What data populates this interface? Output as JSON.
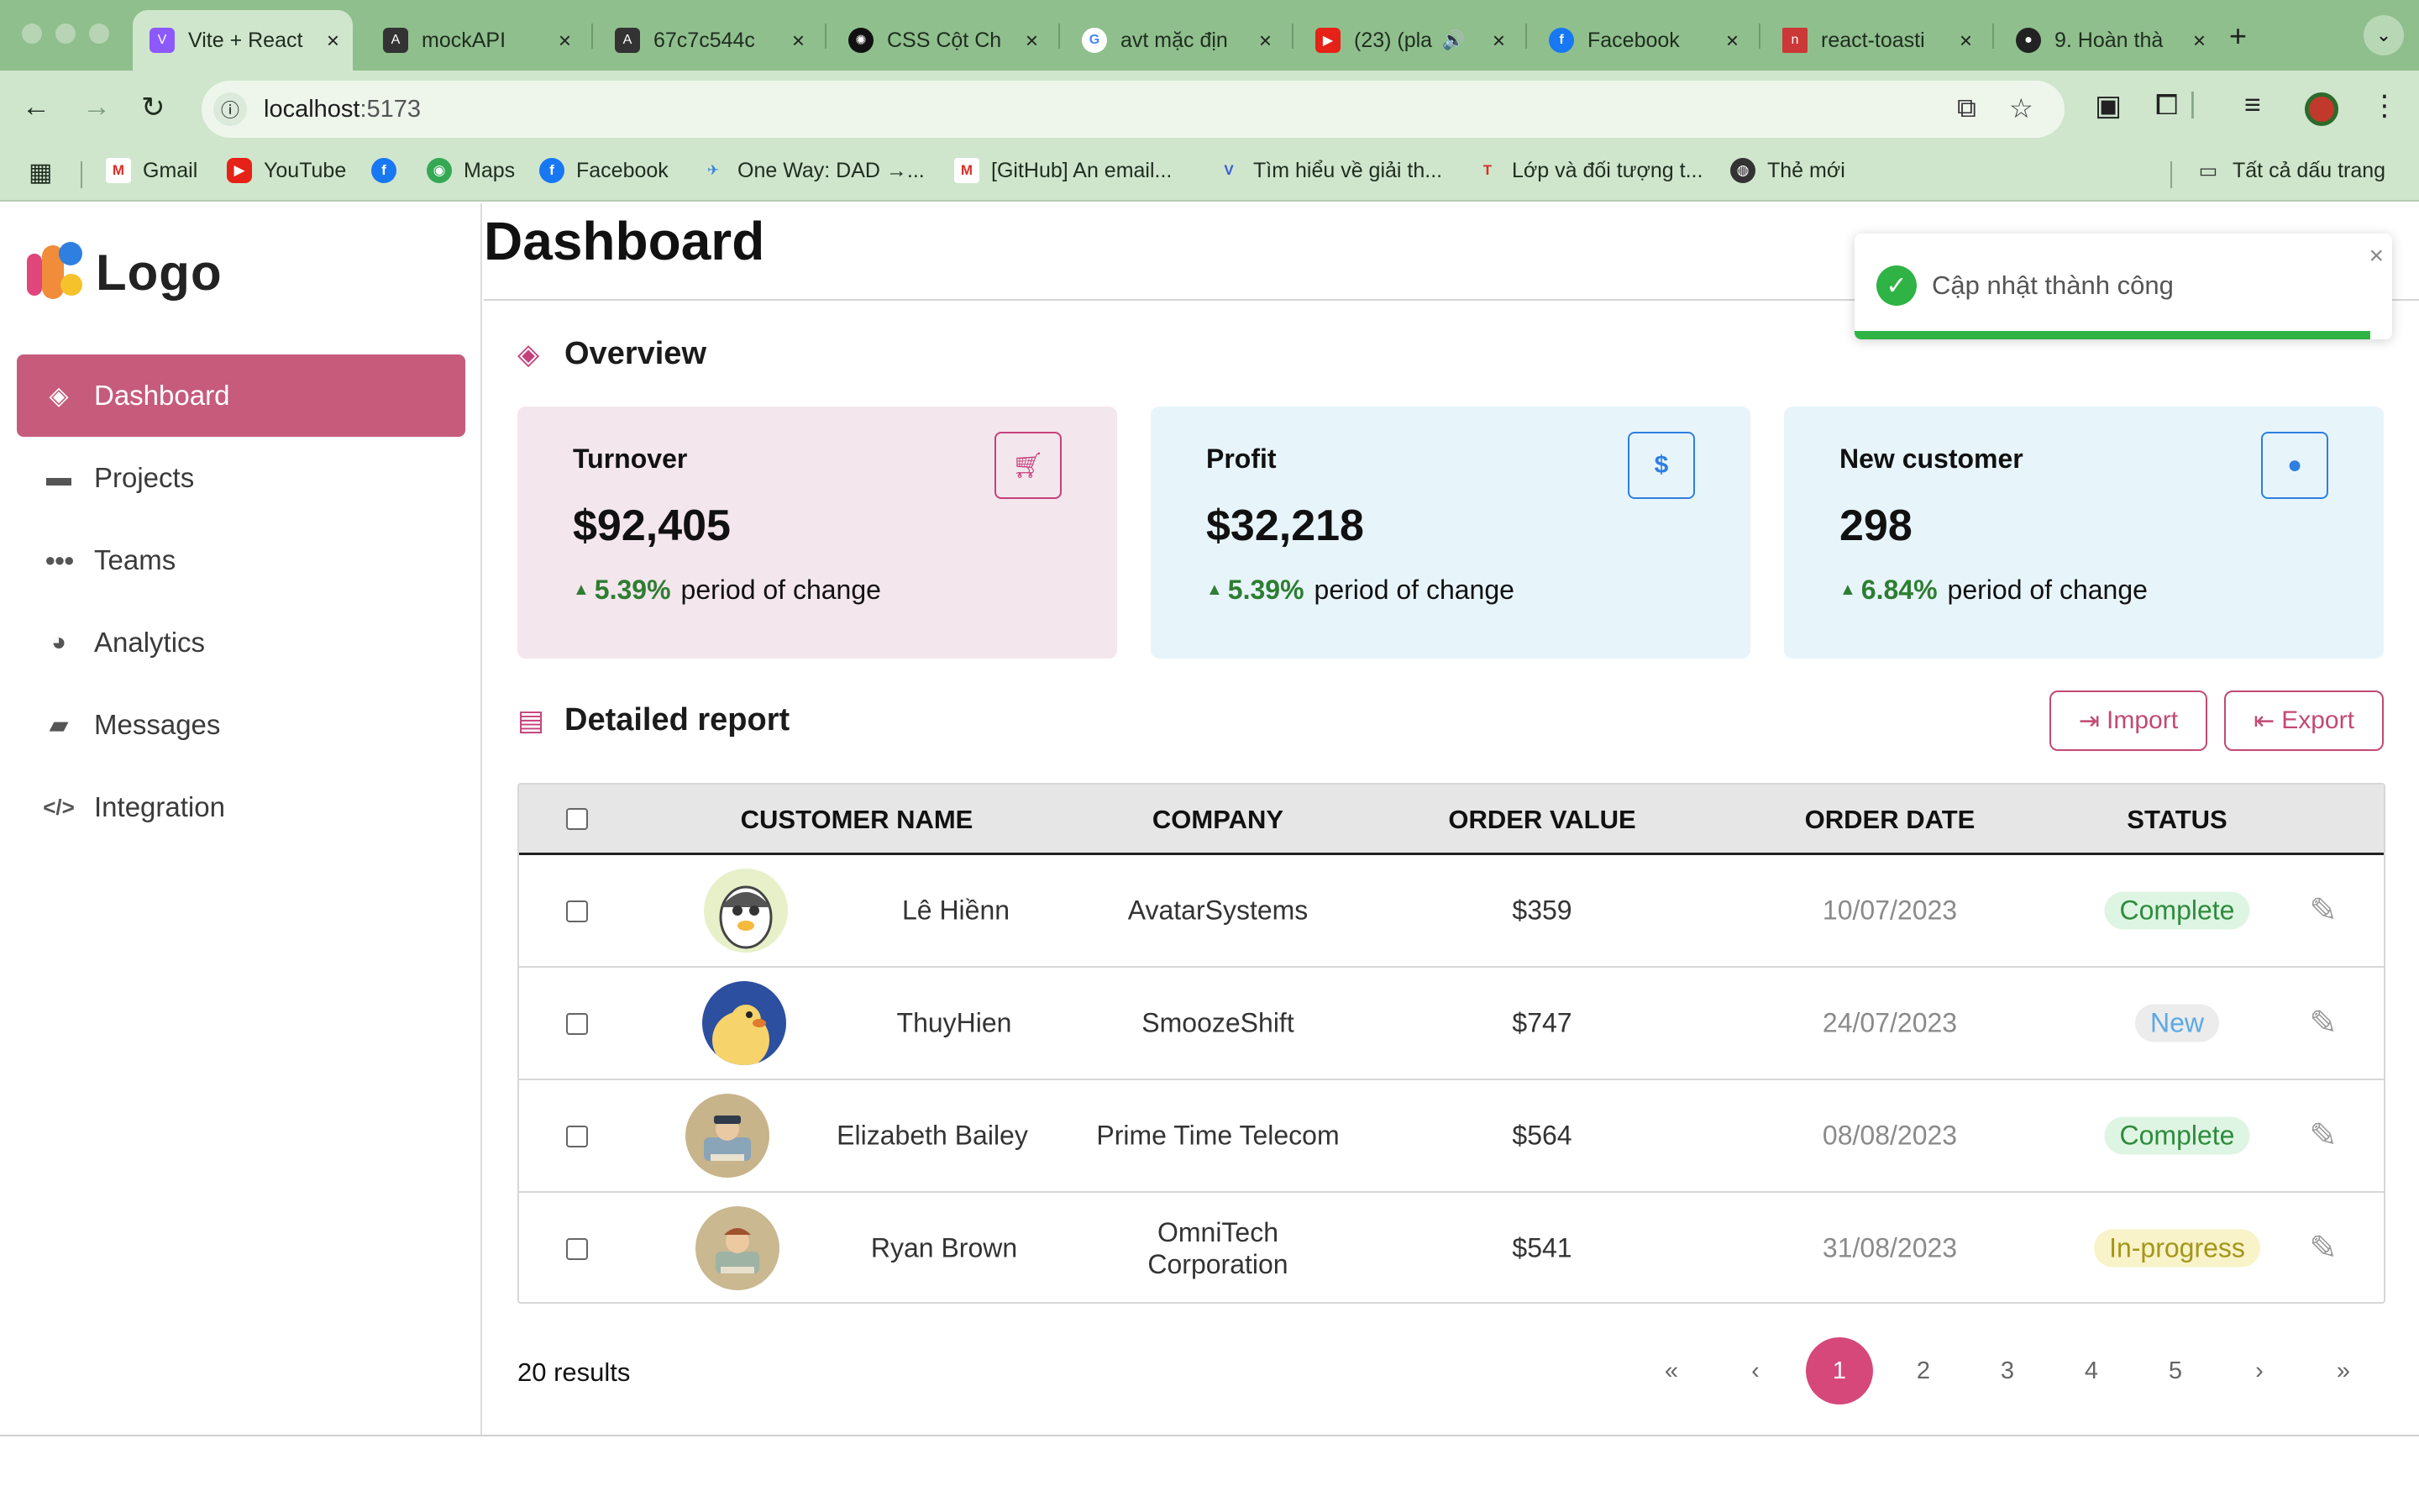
{
  "browser": {
    "tabs": [
      {
        "label": "Vite + React",
        "icon": "vite-icon",
        "active": true
      },
      {
        "label": "mockAPI",
        "icon": "mockapi-icon"
      },
      {
        "label": "67c7c544c",
        "icon": "mockapi-icon"
      },
      {
        "label": "CSS Cột Ch",
        "icon": "chatgpt-icon"
      },
      {
        "label": "avt mặc địn",
        "icon": "google-icon"
      },
      {
        "label": "(23) (pla",
        "icon": "youtube-icon"
      },
      {
        "label": "Facebook",
        "icon": "facebook-icon"
      },
      {
        "label": "react-toasti",
        "icon": "npm-icon"
      },
      {
        "label": "9. Hoàn thà",
        "icon": "github-icon"
      }
    ],
    "url_host": "localhost",
    "url_port": ":5173",
    "bookmarks": [
      {
        "label": "Gmail",
        "icon": "gmail-icon"
      },
      {
        "label": "YouTube",
        "icon": "youtube-icon"
      },
      {
        "label": "",
        "icon": "facebook-icon"
      },
      {
        "label": "Maps",
        "icon": "maps-icon"
      },
      {
        "label": "Facebook",
        "icon": "facebook-icon"
      },
      {
        "label": "One Way: DAD →...",
        "icon": "bird-icon"
      },
      {
        "label": "[GitHub] An email...",
        "icon": "gmail-icon"
      },
      {
        "label": "Tìm hiểu về giải th...",
        "icon": "v-icon"
      },
      {
        "label": "Lớp và đối tượng t...",
        "icon": "t-icon"
      },
      {
        "label": "Thẻ mới",
        "icon": "globe-icon"
      }
    ],
    "all_bookmarks": "Tất cả dấu trang"
  },
  "sidebar": {
    "logo": "Logo",
    "items": [
      {
        "label": "Dashboard",
        "icon": "layers-icon",
        "active": true
      },
      {
        "label": "Projects",
        "icon": "folder-icon"
      },
      {
        "label": "Teams",
        "icon": "team-icon"
      },
      {
        "label": "Analytics",
        "icon": "pie-chart-icon"
      },
      {
        "label": "Messages",
        "icon": "message-icon"
      },
      {
        "label": "Integration",
        "icon": "code-icon"
      }
    ]
  },
  "main": {
    "title": "Dashboard",
    "overview_title": "Overview",
    "cards": [
      {
        "label": "Turnover",
        "value": "$92,405",
        "change": "5.39%",
        "change_text": "period of change",
        "icon": "cart-icon",
        "bg": "#f3e6ec",
        "accent": "#c6407a"
      },
      {
        "label": "Profit",
        "value": "$32,218",
        "change": "5.39%",
        "change_text": "period of change",
        "icon": "dollar-icon",
        "bg": "#e7f5fb",
        "accent": "#2f7fe0"
      },
      {
        "label": "New customer",
        "value": "298",
        "change": "6.84%",
        "change_text": "period of change",
        "icon": "user-icon",
        "bg": "#e7f5fb",
        "accent": "#2f7fe0"
      }
    ],
    "report_title": "Detailed report",
    "import_label": "Import",
    "export_label": "Export",
    "table": {
      "columns": [
        "CUSTOMER NAME",
        "COMPANY",
        "ORDER VALUE",
        "ORDER DATE",
        "STATUS"
      ],
      "rows": [
        {
          "name": "Lê Hiềnn",
          "company": "AvatarSystems",
          "value": "$359",
          "date": "10/07/2023",
          "status": "Complete",
          "avatar": "penguin-avatar"
        },
        {
          "name": "ThuyHien",
          "company": "SmoozeShift",
          "value": "$747",
          "date": "24/07/2023",
          "status": "New",
          "avatar": "duck-avatar"
        },
        {
          "name": "Elizabeth Bailey",
          "company": "Prime Time Telecom",
          "value": "$564",
          "date": "08/08/2023",
          "status": "Complete",
          "avatar": "cartoon-avatar"
        },
        {
          "name": "Ryan Brown",
          "company": "OmniTech Corporation",
          "value": "$541",
          "date": "31/08/2023",
          "status": "In-progress",
          "avatar": "cartoon-avatar"
        }
      ]
    },
    "results": "20 results",
    "pagination": [
      "«",
      "‹",
      "1",
      "2",
      "3",
      "4",
      "5",
      "›",
      "»"
    ],
    "current_page": "1"
  },
  "toast": {
    "message": "Cập nhật thành công",
    "type": "success"
  },
  "colors": {
    "primary": "#c65b7c",
    "accent_pink": "#d6487a",
    "positive": "#2e7d32",
    "status_complete_bg": "#dff5e3",
    "status_complete_fg": "#2e8b3d",
    "status_new_bg": "#ececec",
    "status_new_fg": "#5aa9e6",
    "status_progress_bg": "#f8f3c8",
    "status_progress_fg": "#a3961c"
  }
}
